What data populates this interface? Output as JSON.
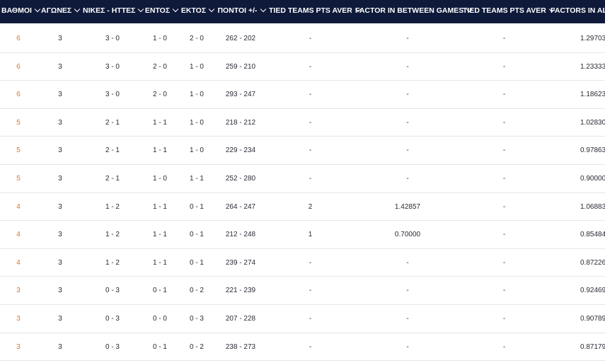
{
  "columns": [
    {
      "label": "ΒΑΘΜΟΙ"
    },
    {
      "label": "ΑΓΩΝΕΣ"
    },
    {
      "label": "ΝΙΚΕΣ - ΗΤΤΕΣ"
    },
    {
      "label": "ΕΝΤΟΣ"
    },
    {
      "label": "ΕΚΤΟΣ"
    },
    {
      "label": "ΠΟΝΤΟΙ +/-"
    },
    {
      "label": "TIED TEAMS PTS AVER"
    },
    {
      "label": "FACTOR IN BETWEEN GAMES"
    },
    {
      "label": "TIED TEAMS PTS AVER"
    },
    {
      "label": "FACTORS IN ALL"
    }
  ],
  "rows": [
    {
      "points": "6",
      "games": "3",
      "wl": "3 - 0",
      "home": "1 - 0",
      "away": "2 - 0",
      "pts": "262 - 202",
      "tied1": "-",
      "factor_between": "-",
      "tied2": "-",
      "factor_all": "1.29703"
    },
    {
      "points": "6",
      "games": "3",
      "wl": "3 - 0",
      "home": "2 - 0",
      "away": "1 - 0",
      "pts": "259 - 210",
      "tied1": "-",
      "factor_between": "-",
      "tied2": "-",
      "factor_all": "1.23333"
    },
    {
      "points": "6",
      "games": "3",
      "wl": "3 - 0",
      "home": "2 - 0",
      "away": "1 - 0",
      "pts": "293 - 247",
      "tied1": "-",
      "factor_between": "-",
      "tied2": "-",
      "factor_all": "1.18623"
    },
    {
      "points": "5",
      "games": "3",
      "wl": "2 - 1",
      "home": "1 - 1",
      "away": "1 - 0",
      "pts": "218 - 212",
      "tied1": "-",
      "factor_between": "-",
      "tied2": "-",
      "factor_all": "1.02830"
    },
    {
      "points": "5",
      "games": "3",
      "wl": "2 - 1",
      "home": "1 - 1",
      "away": "1 - 0",
      "pts": "229 - 234",
      "tied1": "-",
      "factor_between": "-",
      "tied2": "-",
      "factor_all": "0.97863"
    },
    {
      "points": "5",
      "games": "3",
      "wl": "2 - 1",
      "home": "1 - 0",
      "away": "1 - 1",
      "pts": "252 - 280",
      "tied1": "-",
      "factor_between": "-",
      "tied2": "-",
      "factor_all": "0.90000"
    },
    {
      "points": "4",
      "games": "3",
      "wl": "1 - 2",
      "home": "1 - 1",
      "away": "0 - 1",
      "pts": "264 - 247",
      "tied1": "2",
      "factor_between": "1.42857",
      "tied2": "-",
      "factor_all": "1.06883"
    },
    {
      "points": "4",
      "games": "3",
      "wl": "1 - 2",
      "home": "1 - 1",
      "away": "0 - 1",
      "pts": "212 - 248",
      "tied1": "1",
      "factor_between": "0.70000",
      "tied2": "-",
      "factor_all": "0.85484"
    },
    {
      "points": "4",
      "games": "3",
      "wl": "1 - 2",
      "home": "1 - 1",
      "away": "0 - 1",
      "pts": "239 - 274",
      "tied1": "-",
      "factor_between": "-",
      "tied2": "-",
      "factor_all": "0.87226"
    },
    {
      "points": "3",
      "games": "3",
      "wl": "0 - 3",
      "home": "0 - 1",
      "away": "0 - 2",
      "pts": "221 - 239",
      "tied1": "-",
      "factor_between": "-",
      "tied2": "-",
      "factor_all": "0.92469"
    },
    {
      "points": "3",
      "games": "3",
      "wl": "0 - 3",
      "home": "0 - 0",
      "away": "0 - 3",
      "pts": "207 - 228",
      "tied1": "-",
      "factor_between": "-",
      "tied2": "-",
      "factor_all": "0.90789"
    },
    {
      "points": "3",
      "games": "3",
      "wl": "0 - 3",
      "home": "0 - 1",
      "away": "0 - 2",
      "pts": "238 - 273",
      "tied1": "-",
      "factor_between": "-",
      "tied2": "-",
      "factor_all": "0.87179"
    }
  ],
  "colors": {
    "header_bg": "#0f1a3a",
    "header_text": "#ffffff",
    "points_accent": "#d9772d",
    "cell_text": "#2a2a35",
    "row_divider": "#e6e6ea"
  },
  "icons": {
    "sort": "chevron-down-icon"
  }
}
